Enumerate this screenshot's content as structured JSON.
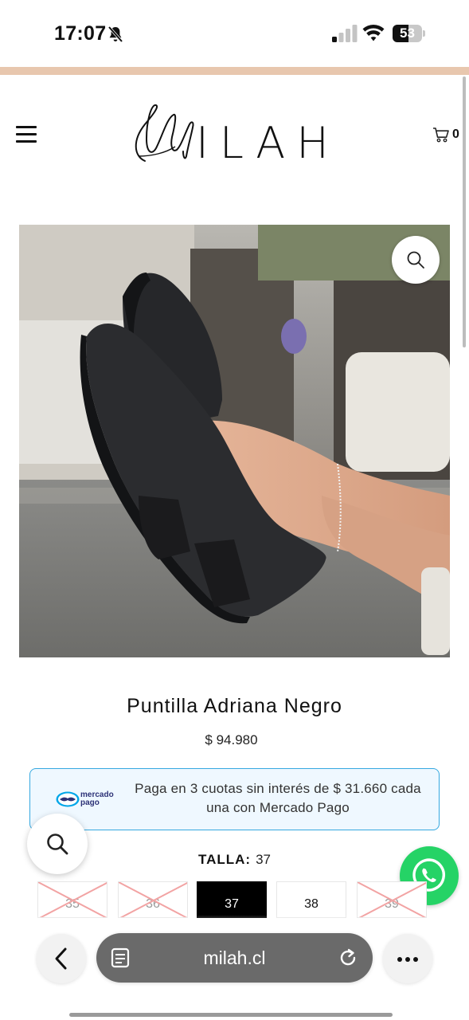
{
  "status_bar": {
    "time": "17:07",
    "icons": [
      "bell-slash-icon",
      "cellular-signal-icon",
      "wifi-icon"
    ],
    "battery_level": "53",
    "battery_fraction": 0.53
  },
  "header": {
    "logo_text": "ILAH",
    "cart_count": "0",
    "icons": [
      "hamburger-menu-icon",
      "shopping-cart-icon"
    ]
  },
  "product": {
    "title": "Puntilla Adriana Negro",
    "price": "$ 94.980",
    "payment": {
      "provider_line1": "mercado",
      "provider_line2": "pago",
      "message": "Paga en 3 cuotas sin interés de $ 31.660 cada una con Mercado Pago"
    },
    "size_label": "TALLA:",
    "selected_size": "37",
    "sizes": [
      {
        "label": "35",
        "state": "unavailable"
      },
      {
        "label": "36",
        "state": "unavailable"
      },
      {
        "label": "37",
        "state": "selected"
      },
      {
        "label": "38",
        "state": "available"
      },
      {
        "label": "39",
        "state": "unavailable"
      }
    ]
  },
  "browser": {
    "url": "milah.cl",
    "icons": [
      "back-chevron-icon",
      "tabs-icon",
      "reload-icon",
      "more-icon"
    ]
  },
  "colors": {
    "accent_strip": "#e8c7ae",
    "mercado_pago_border": "#35a8e0",
    "mercado_pago_bg": "#eff8ff",
    "whatsapp": "#25d366",
    "selected_size": "#000000"
  }
}
